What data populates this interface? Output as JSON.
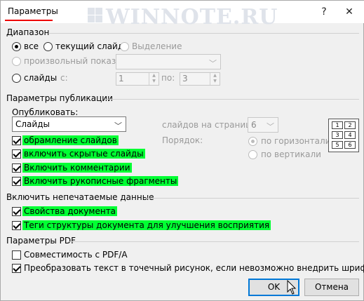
{
  "window": {
    "title": "Параметры",
    "watermark": "WINNOTE.RU"
  },
  "range": {
    "heading": "Диапазон",
    "all": "все",
    "current_slide": "текущий слайд",
    "selection": "Выделение",
    "custom_show": "произвольный показ:",
    "slides": "слайды",
    "from_label": "с:",
    "from_value": "1",
    "to_label": "по:",
    "to_value": "3"
  },
  "publish": {
    "heading": "Параметры публикации",
    "publish_label": "Опубликовать:",
    "publish_value": "Слайды",
    "frame_slides": "обрамление слайдов",
    "include_hidden": "включить скрытые слайды",
    "include_comments": "Включить комментарии",
    "include_ink": "Включить рукописные фрагменты",
    "slides_per_page_label": "слайдов на странице:",
    "slides_per_page_value": "6",
    "order_label": "Порядок:",
    "horizontal": "по горизонтали",
    "vertical": "по вертикали",
    "preview_pages": [
      "1",
      "2",
      "3",
      "4",
      "5",
      "6"
    ]
  },
  "nonprint": {
    "heading": "Включить непечатаемые данные",
    "doc_props": "Свойства документа",
    "struct_tags": "Теги структуры документа для улучшения восприятия"
  },
  "pdf": {
    "heading": "Параметры PDF",
    "pdfa": "Совместимость с PDF/A",
    "bitmap": "Преобразовать текст в точечный рисунок, если невозможно внедрить шрифты"
  },
  "buttons": {
    "ok": "OK",
    "cancel": "Отмена",
    "help": "?",
    "close": "✕"
  },
  "colors": {
    "highlight": "#00ff33",
    "accent": "#0078d7",
    "title_underline": "#ee0000"
  }
}
